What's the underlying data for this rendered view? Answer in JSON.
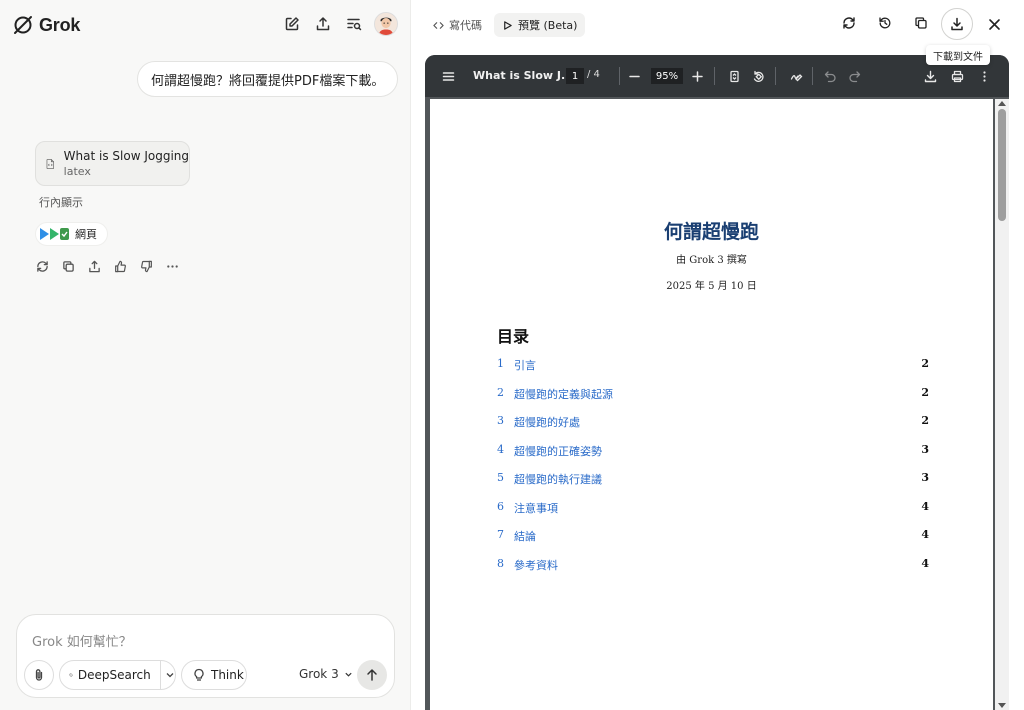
{
  "app": {
    "logo_text": "Grok"
  },
  "chat": {
    "user_message": "何謂超慢跑？將回覆提供PDF檔案下載。",
    "file_card": {
      "title": "What is Slow Jogging",
      "type": "latex"
    },
    "inline_label": "行內顯示",
    "web_pill": "網頁"
  },
  "composer": {
    "placeholder": "Grok 如何幫忙？",
    "deepsearch_label": "DeepSearch",
    "think_label": "Think",
    "model_label": "Grok 3"
  },
  "preview": {
    "tab_code": "寫代碼",
    "tab_preview": "預覽 (Beta)",
    "download_tooltip": "下載到文件"
  },
  "pdf_viewer": {
    "title": "What is Slow J...",
    "current_page": "1",
    "page_separator": "/ 4",
    "zoom": "95%"
  },
  "document": {
    "title": "何謂超慢跑",
    "author": "由 Grok 3 撰寫",
    "date": "2025 年 5 月 10 日",
    "toc_heading": "目录",
    "toc": [
      {
        "num": "1",
        "text": "引言",
        "page": "2"
      },
      {
        "num": "2",
        "text": "超慢跑的定義與起源",
        "page": "2"
      },
      {
        "num": "3",
        "text": "超慢跑的好處",
        "page": "2"
      },
      {
        "num": "4",
        "text": "超慢跑的正確姿勢",
        "page": "3"
      },
      {
        "num": "5",
        "text": "超慢跑的執行建議",
        "page": "3"
      },
      {
        "num": "6",
        "text": "注意事項",
        "page": "4"
      },
      {
        "num": "7",
        "text": "結論",
        "page": "4"
      },
      {
        "num": "8",
        "text": "參考資料",
        "page": "4"
      }
    ]
  },
  "colors": {
    "doc_title": "#1a3f72",
    "toc_link": "#2a6bc9",
    "pdf_toolbar": "#323639",
    "pdf_background": "#525659",
    "left_pane_bg": "#f8f8f7"
  },
  "icons": {
    "top_left": [
      "compose-icon",
      "share-icon",
      "history-search-icon"
    ],
    "message_actions": [
      "regenerate-icon",
      "copy-icon",
      "share-icon",
      "thumbs-up-icon",
      "thumbs-down-icon",
      "more-icon"
    ],
    "preview_actions": [
      "refresh-icon",
      "history-icon",
      "copy-icon",
      "download-icon",
      "close-icon"
    ]
  }
}
